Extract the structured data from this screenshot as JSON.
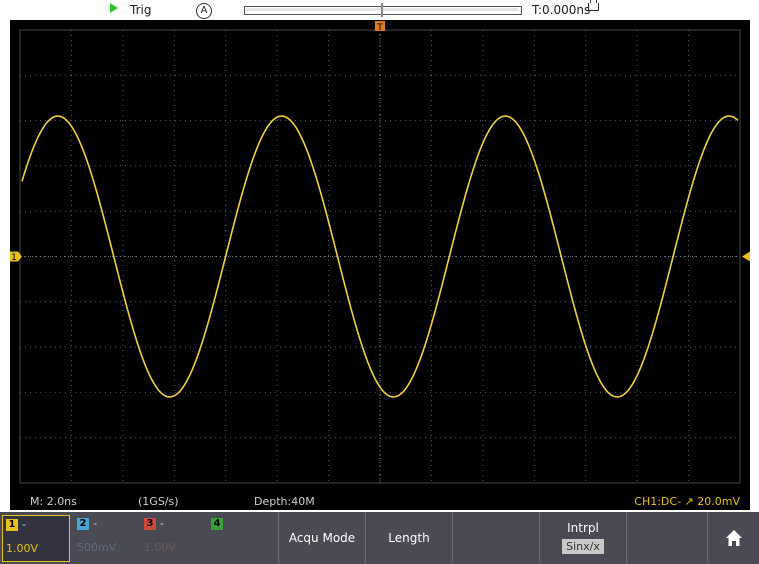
{
  "status_bar": {
    "trigger_status": "Trig",
    "trigger_mode_icon": "auto-A-icon",
    "time_offset": "T:0.000ns"
  },
  "info_strip": {
    "timebase": "M: 2.0ns",
    "sample_rate": "(1GS/s)",
    "record_depth": "Depth:40M",
    "trigger_readout": "CH1:DC- ↗ 20.0mV"
  },
  "channels": [
    {
      "num": "1",
      "scale": "1.00V",
      "active": true,
      "color": "#e8c01a"
    },
    {
      "num": "2",
      "scale": "500mV",
      "active": false,
      "color": "#4aa3d8"
    },
    {
      "num": "3",
      "scale": "1.00V",
      "active": false,
      "color": "#d04a3a"
    },
    {
      "num": "4",
      "scale": "",
      "active": false,
      "color": "#3aa03a"
    }
  ],
  "menu": {
    "acqu_mode": "Acqu Mode",
    "length": "Length",
    "interpolation_label": "Intrpl",
    "interpolation_value": "Sinx/x",
    "home_icon": "home-icon"
  },
  "markers": {
    "trigger_position_label": "T",
    "channel1_ground_label": "1"
  },
  "waveform": {
    "type": "sine",
    "color": "#f0d040",
    "periods_visible": 3.2,
    "amplitude_divs": 3.1
  }
}
